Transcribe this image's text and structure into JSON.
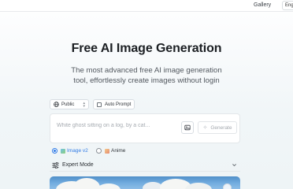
{
  "topbar": {
    "gallery_label": "Gallery",
    "language_label": "English"
  },
  "hero": {
    "title": "Free AI Image Generation",
    "subtitle": "The most advanced free AI image generation tool, effortlessly create images without login"
  },
  "controls": {
    "visibility_label": "Public",
    "auto_prompt_label": "Auto Prompt",
    "auto_prompt_checked": false
  },
  "prompt": {
    "value": "",
    "placeholder": "White ghost sitting on a log, by a cat...",
    "generate_label": "Generate"
  },
  "models": {
    "options": [
      {
        "label": "Image v2",
        "selected": true
      },
      {
        "label": "Anime",
        "selected": false
      }
    ]
  },
  "expert_mode": {
    "label": "Expert Mode"
  },
  "colors": {
    "accent": "#2f7ae5",
    "sky": "#74aee0"
  }
}
